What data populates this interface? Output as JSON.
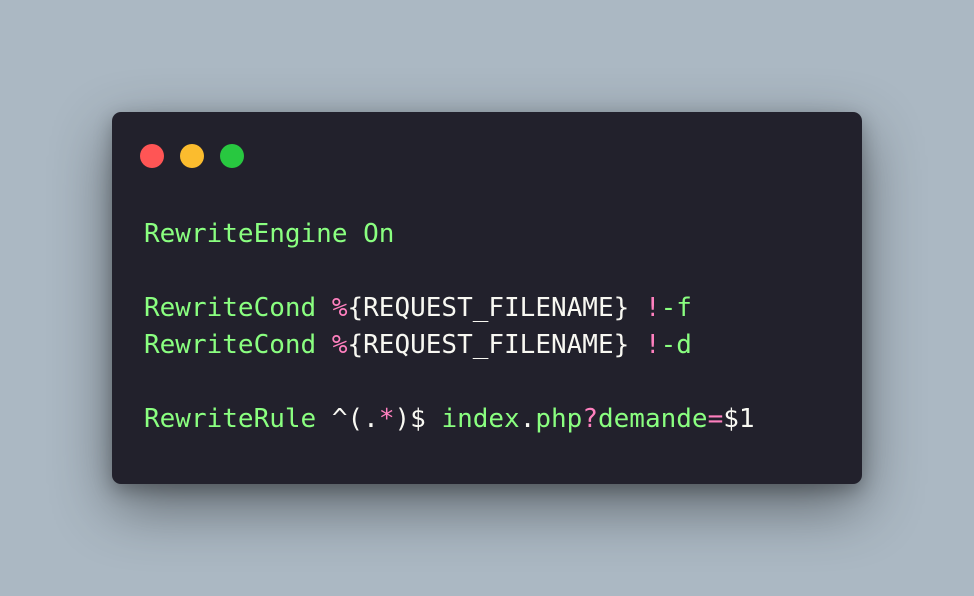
{
  "window": {
    "background": "#22212c",
    "controls": [
      {
        "name": "close",
        "color": "#ff5555"
      },
      {
        "name": "minimize",
        "color": "#fbbc2e"
      },
      {
        "name": "maximize",
        "color": "#28c840"
      }
    ]
  },
  "colors": {
    "keyword": "#8aff80",
    "operator": "#ff80bf",
    "text": "#f8f8f2"
  },
  "code": {
    "language": "apache",
    "lines": [
      [
        {
          "text": "RewriteEngine On",
          "type": "keyword"
        }
      ],
      [],
      [
        {
          "text": "RewriteCond",
          "type": "keyword"
        },
        {
          "text": " ",
          "type": "text"
        },
        {
          "text": "%",
          "type": "operator"
        },
        {
          "text": "{REQUEST_FILENAME}",
          "type": "text"
        },
        {
          "text": " ",
          "type": "text"
        },
        {
          "text": "!",
          "type": "operator"
        },
        {
          "text": "-f",
          "type": "keyword"
        }
      ],
      [
        {
          "text": "RewriteCond",
          "type": "keyword"
        },
        {
          "text": " ",
          "type": "text"
        },
        {
          "text": "%",
          "type": "operator"
        },
        {
          "text": "{REQUEST_FILENAME}",
          "type": "text"
        },
        {
          "text": " ",
          "type": "text"
        },
        {
          "text": "!",
          "type": "operator"
        },
        {
          "text": "-d",
          "type": "keyword"
        }
      ],
      [],
      [
        {
          "text": "RewriteRule",
          "type": "keyword"
        },
        {
          "text": " ^(.",
          "type": "text"
        },
        {
          "text": "*",
          "type": "operator"
        },
        {
          "text": ")$ ",
          "type": "text"
        },
        {
          "text": "index",
          "type": "keyword"
        },
        {
          "text": ".",
          "type": "text"
        },
        {
          "text": "php",
          "type": "keyword"
        },
        {
          "text": "?",
          "type": "operator"
        },
        {
          "text": "demande",
          "type": "keyword"
        },
        {
          "text": "=",
          "type": "operator"
        },
        {
          "text": "$1",
          "type": "text"
        }
      ]
    ]
  }
}
